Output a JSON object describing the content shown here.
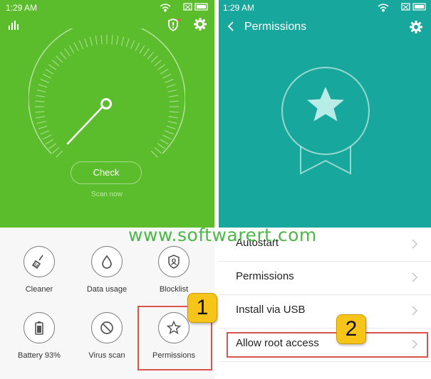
{
  "left_screen": {
    "status_time": "1:29 AM",
    "status_icons": "wifi-signal-battery",
    "check_button": "Check",
    "scan_now": "Scan now",
    "grid": [
      {
        "label": "Cleaner",
        "icon": "broom-icon"
      },
      {
        "label": "Data usage",
        "icon": "drop-icon"
      },
      {
        "label": "Blocklist",
        "icon": "shield-user-icon"
      },
      {
        "label": "Battery 93%",
        "icon": "battery-icon"
      },
      {
        "label": "Virus scan",
        "icon": "virus-scan-icon"
      },
      {
        "label": "Permissions",
        "icon": "star-icon"
      }
    ],
    "callout": "1"
  },
  "right_screen": {
    "status_time": "1:29 AM",
    "title": "Permissions",
    "list": [
      {
        "label": "Autostart"
      },
      {
        "label": "Permissions"
      },
      {
        "label": "Install via USB"
      },
      {
        "label": "Allow root access"
      }
    ],
    "callout": "2"
  },
  "watermark": "www.softwarert.com",
  "colors": {
    "left_header": "#5cbd2c",
    "right_header": "#17a79c",
    "callout": "#f7c519",
    "highlight_box": "#d9534f",
    "watermark": "#4cb848"
  }
}
